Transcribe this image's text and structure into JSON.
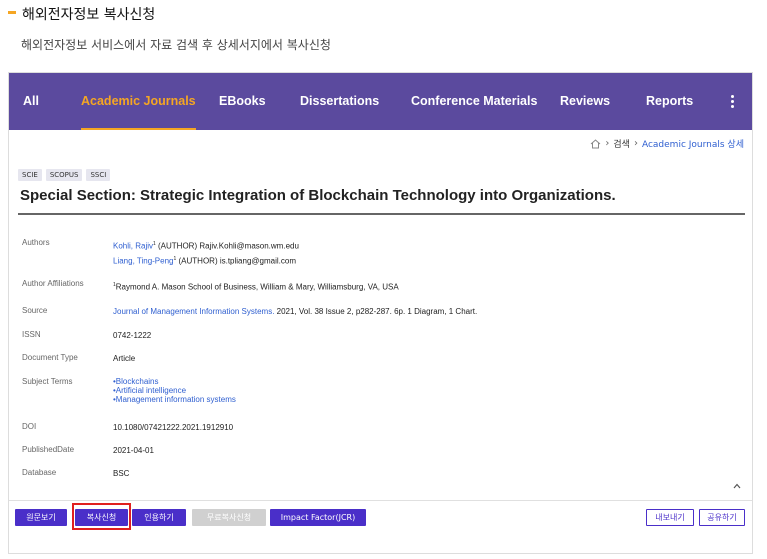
{
  "page": {
    "heading": "해외전자정보 복사신청",
    "subheading": "해외전자정보 서비스에서 자료 검색 후 상세서지에서 복사신청"
  },
  "nav": {
    "items": [
      {
        "label": "All",
        "active": false
      },
      {
        "label": "Academic Journals",
        "active": true
      },
      {
        "label": "EBooks",
        "active": false
      },
      {
        "label": "Dissertations",
        "active": false
      },
      {
        "label": "Conference Materials",
        "active": false
      },
      {
        "label": "Reviews",
        "active": false
      },
      {
        "label": "Reports",
        "active": false
      }
    ],
    "more_icon": "more-vertical-icon"
  },
  "breadcrumb": {
    "home_icon": "home-icon",
    "items": [
      "검색",
      "Academic Journals 상세"
    ]
  },
  "tags": [
    "SCIE",
    "SCOPUS",
    "SSCI"
  ],
  "article": {
    "title": "Special Section: Strategic Integration of Blockchain Technology into Organizations.",
    "authors_label": "Authors",
    "authors": [
      {
        "name": "Kohli, Rajiv",
        "sup": "1",
        "rest": " (AUTHOR) Rajiv.Kohli@mason.wm.edu"
      },
      {
        "name": "Liang, Ting-Peng",
        "sup": "1",
        "rest": " (AUTHOR) is.tpliang@gmail.com"
      }
    ],
    "affiliations_label": "Author Affiliations",
    "affiliation_sup": "1",
    "affiliation": "Raymond A. Mason School of Business, William & Mary, Williamsburg, VA, USA",
    "source_label": "Source",
    "source_link": "Journal of Management Information Systems.",
    "source_rest": " 2021, Vol. 38 Issue 2, p282-287. 6p. 1 Diagram, 1 Chart.",
    "issn_label": "ISSN",
    "issn": "0742-1222",
    "doctype_label": "Document Type",
    "doctype": "Article",
    "subjects_label": "Subject Terms",
    "subjects": [
      "•Blockchains",
      "•Artificial intelligence",
      "•Management information systems"
    ],
    "doi_label": "DOI",
    "doi": "10.1080/07421222.2021.1912910",
    "pubdate_label": "PublishedDate",
    "pubdate": "2021-04-01",
    "database_label": "Database",
    "database": "BSC"
  },
  "buttons": {
    "fulltext": "원문보기",
    "copy_request": "복사신청",
    "cite": "인용하기",
    "free_copy": "무료복사신청",
    "impact_factor": "Impact Factor(JCR)",
    "export": "내보내기",
    "share": "공유하기"
  },
  "colors": {
    "nav_bg": "#5b4a9e",
    "accent": "#f5a623",
    "button_primary": "#4a2fc9",
    "link": "#2f5fd0",
    "highlight": "#e0201f"
  }
}
